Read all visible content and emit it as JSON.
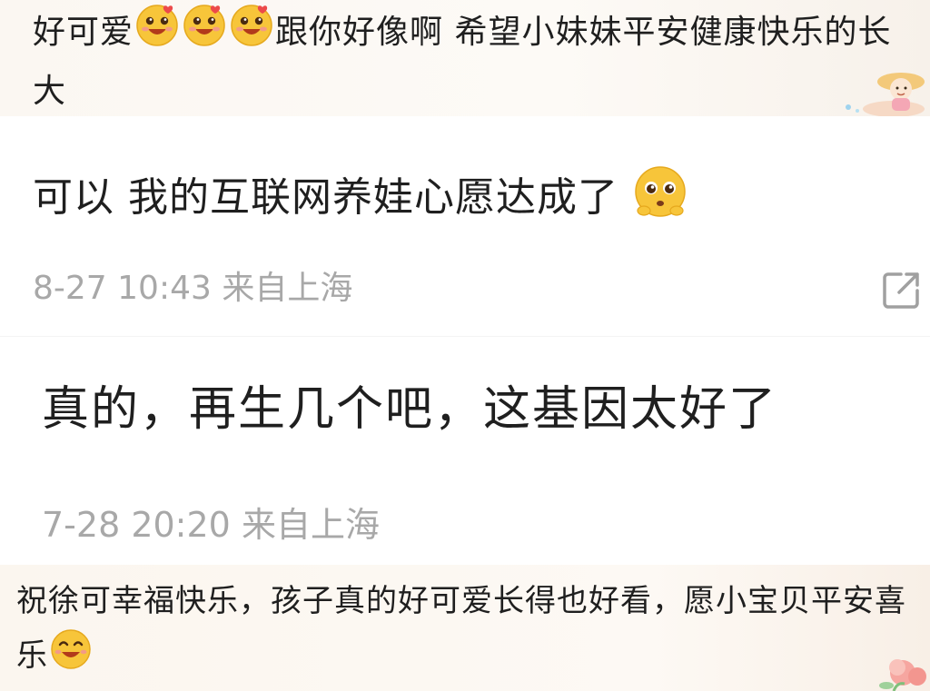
{
  "comments": [
    {
      "text_before_emoji": "好可爱",
      "emojis": [
        "grinning-heart-face",
        "grinning-heart-face",
        "grinning-heart-face"
      ],
      "text_after_emoji": "跟你好像啊 希望小妹妹平安健康快乐的长大"
    },
    {
      "text": "可以 我的互联网养娃心愿达成了",
      "emoji": "pleading-face",
      "time": "8-27 10:43",
      "location": "来自上海"
    },
    {
      "text": "真的，再生几个吧，这基因太好了",
      "time": "7-28 20:20",
      "location": "来自上海"
    },
    {
      "text": "祝徐可幸福快乐，孩子真的好可爱长得也好看，愿小宝贝平安喜乐",
      "emoji": "happy-face"
    }
  ],
  "colors": {
    "text": "#1f1f1f",
    "meta": "#a8a8a8",
    "emoji_face": "#f7c53a"
  }
}
